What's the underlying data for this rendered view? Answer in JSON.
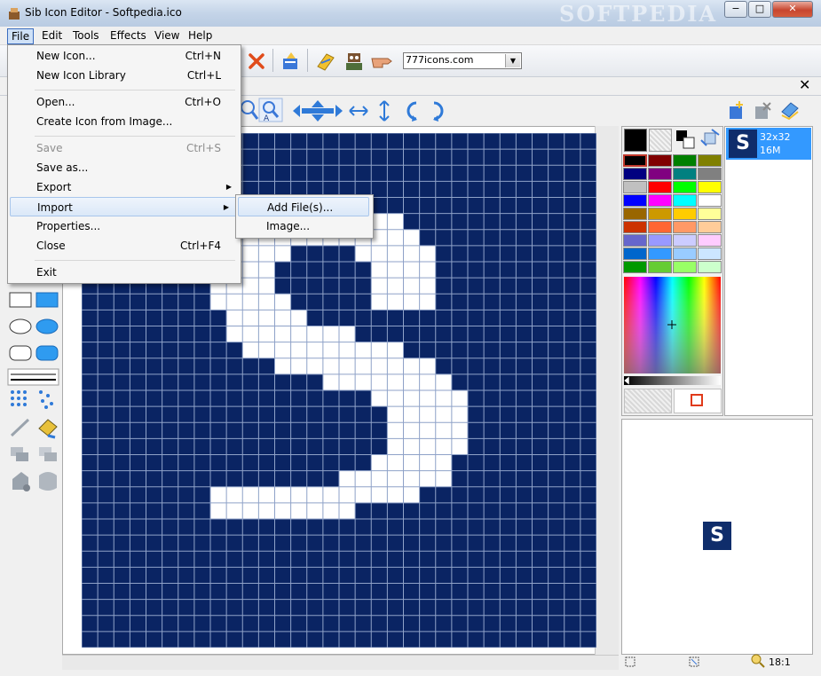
{
  "window": {
    "title": "Sib Icon Editor - Softpedia.ico",
    "watermark": "SOFTPEDIA",
    "controls": {
      "minimize": "−",
      "maximize": "□",
      "close": "✕"
    }
  },
  "menubar": [
    "File",
    "Edit",
    "Tools",
    "Effects",
    "View",
    "Help"
  ],
  "toolbar": {
    "site_combo_value": "777icons.com",
    "icons": [
      "cut-icon",
      "paste-icon",
      "magic-wand-icon",
      "robot-icon",
      "pointing-hand-icon"
    ]
  },
  "file_menu": {
    "items": [
      {
        "label": "New Icon...",
        "shortcut": "Ctrl+N"
      },
      {
        "label": "New Icon Library",
        "shortcut": "Ctrl+L"
      },
      {
        "label": "Open...",
        "shortcut": "Ctrl+O"
      },
      {
        "label": "Create Icon from Image...",
        "shortcut": ""
      },
      {
        "label": "Save",
        "shortcut": "Ctrl+S",
        "disabled": true
      },
      {
        "label": "Save as...",
        "shortcut": ""
      },
      {
        "label": "Export",
        "shortcut": "",
        "submenu": true
      },
      {
        "label": "Import",
        "shortcut": "",
        "submenu": true,
        "highlighted": true
      },
      {
        "label": "Properties...",
        "shortcut": ""
      },
      {
        "label": "Close",
        "shortcut": "Ctrl+F4"
      },
      {
        "label": "Exit",
        "shortcut": ""
      }
    ]
  },
  "import_submenu": {
    "items": [
      {
        "label": "Add File(s)..."
      },
      {
        "label": "Image..."
      }
    ]
  },
  "palette": {
    "colors": [
      "#000000",
      "#800000",
      "#008000",
      "#808000",
      "#000080",
      "#800080",
      "#008080",
      "#808080",
      "#c0c0c0",
      "#ff0000",
      "#00ff00",
      "#ffff00",
      "#0000ff",
      "#ff00ff",
      "#00ffff",
      "#ffffff",
      "#996600",
      "#cc9900",
      "#ffcc00",
      "#ffff99",
      "#cc3300",
      "#ff6633",
      "#ff9966",
      "#ffcc99",
      "#6666cc",
      "#9999ff",
      "#ccccff",
      "#ffccff",
      "#0066cc",
      "#3399ff",
      "#99ccff",
      "#cce6ff",
      "#009900",
      "#66cc33",
      "#99ff66",
      "#ccffcc"
    ],
    "primary_color": "#000000"
  },
  "image_formats": [
    {
      "size": "32x32",
      "depth": "16M",
      "glyph": "S"
    }
  ],
  "preview": {
    "glyph": "S"
  },
  "canvas": {
    "background": "#0a2463",
    "grid_size": 32,
    "letter": "S"
  },
  "status": {
    "zoom": "18:1"
  }
}
